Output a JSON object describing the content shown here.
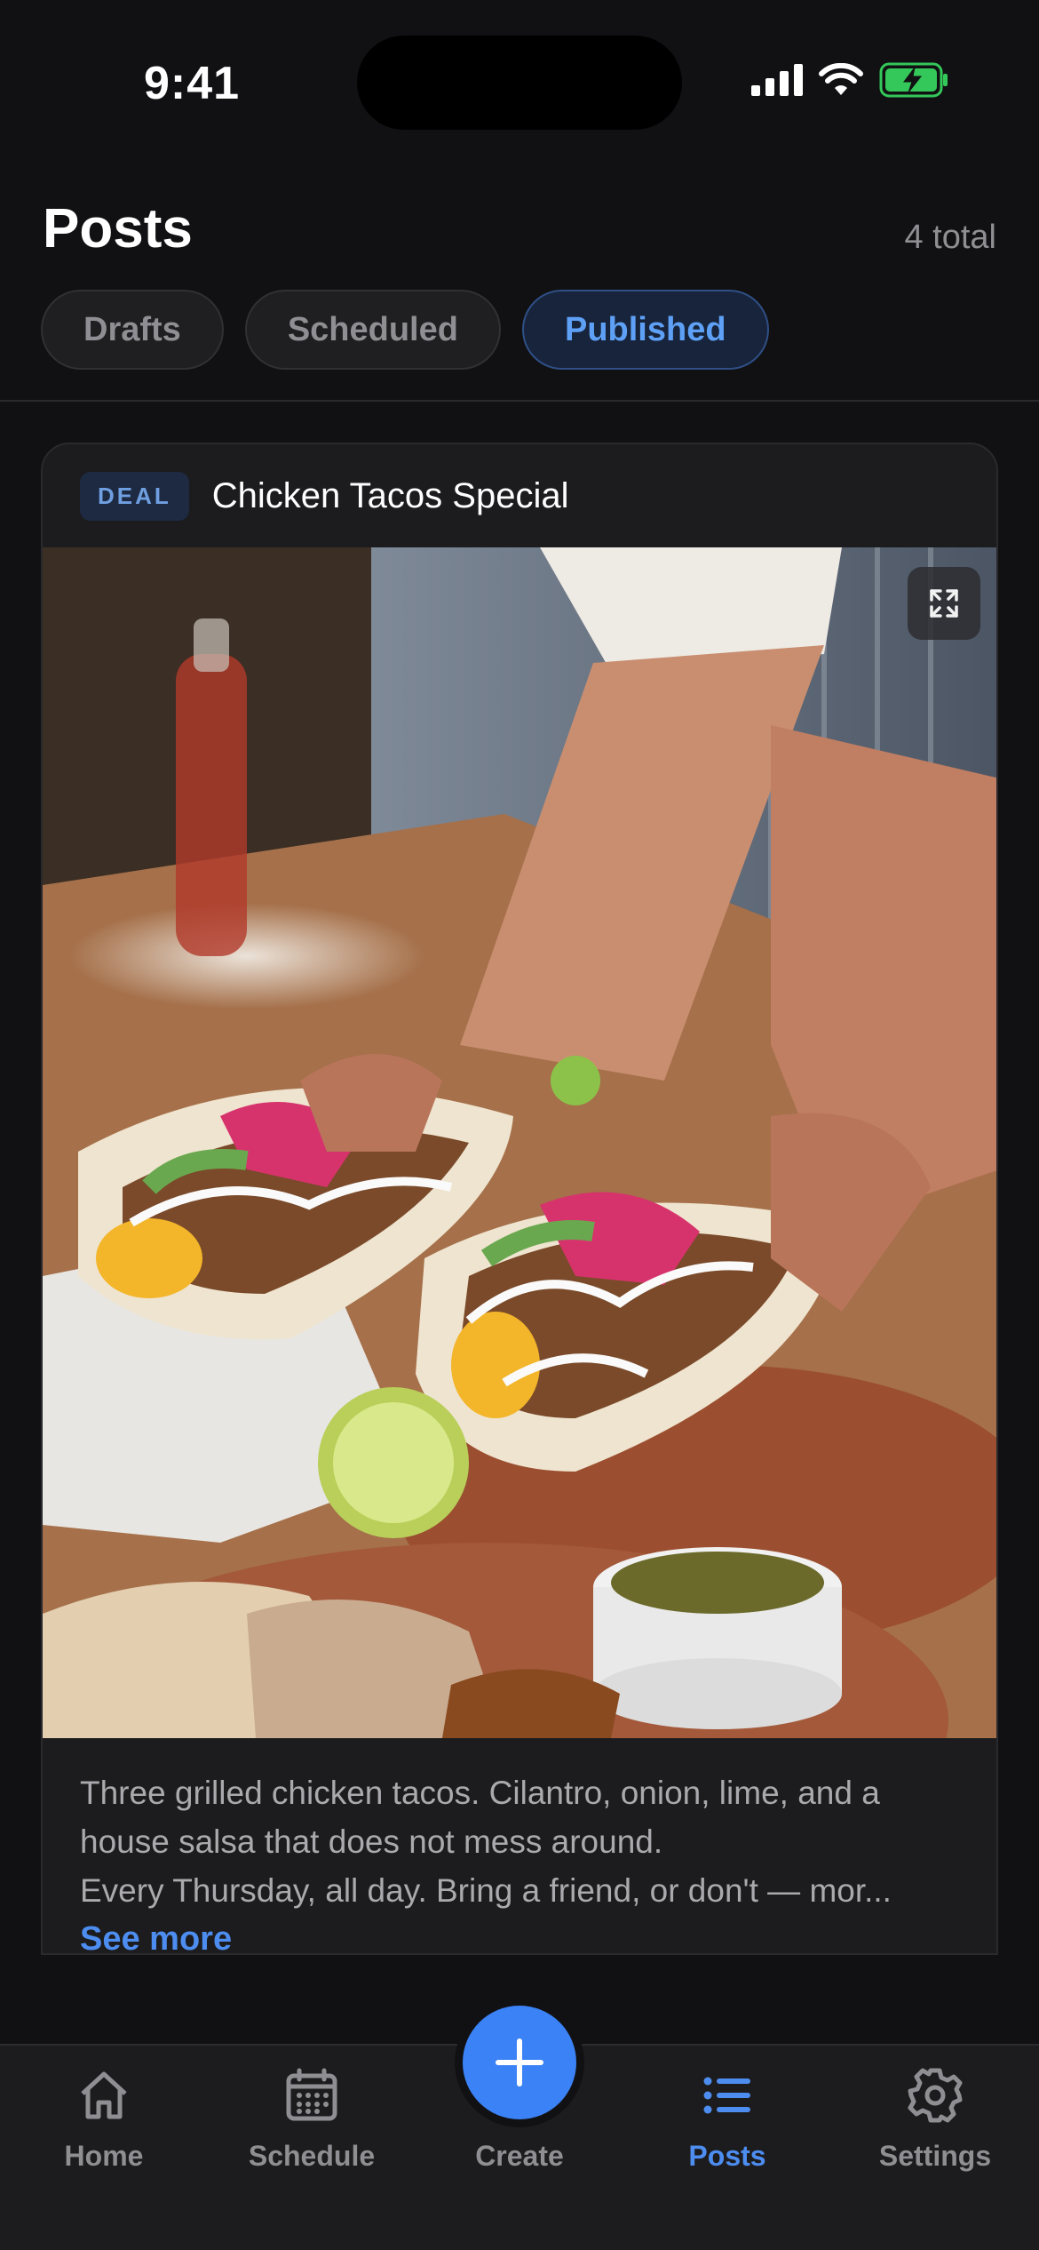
{
  "status_bar": {
    "time": "9:41"
  },
  "header": {
    "title": "Posts",
    "count": "4 total"
  },
  "filters": [
    {
      "label": "Drafts",
      "active": false
    },
    {
      "label": "Scheduled",
      "active": false
    },
    {
      "label": "Published",
      "active": true
    }
  ],
  "post": {
    "badge": "DEAL",
    "title": "Chicken Tacos Special",
    "description": "Three grilled chicken tacos. Cilantro, onion, lime, and a house salsa that does not mess around.\nEvery Thursday, all day. Bring a friend, or don't — mor...",
    "see_more": "See more"
  },
  "nav": {
    "home": "Home",
    "schedule": "Schedule",
    "create": "Create",
    "posts": "Posts",
    "settings": "Settings"
  },
  "colors": {
    "accent": "#3b82f6",
    "background": "#111113",
    "card": "#1c1c1e",
    "battery": "#34c759"
  }
}
